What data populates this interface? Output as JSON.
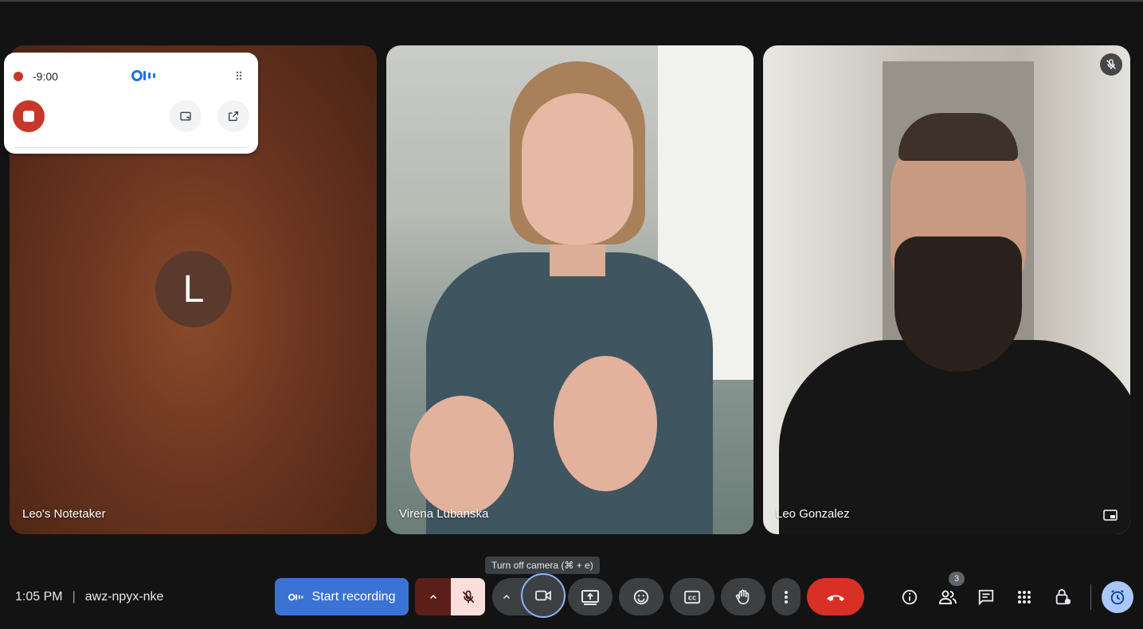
{
  "participants": [
    {
      "name": "Leo's Notetaker",
      "initial": "L"
    },
    {
      "name": "Virena Lubanska"
    },
    {
      "name": "Leo Gonzalez",
      "muted": true
    }
  ],
  "otter_widget": {
    "timer": "-9:00",
    "logo_icon": "otter-logo-icon"
  },
  "meeting": {
    "time": "1:05 PM",
    "separator": "|",
    "code": "awz-npyx-nke"
  },
  "controls": {
    "start_recording_label": "Start recording",
    "camera_tooltip": "Turn off camera (⌘ + e)",
    "people_count": "3"
  },
  "colors": {
    "record_red": "#c5382a",
    "accent_blue": "#3b73d4",
    "hangup_red": "#d93025",
    "mic_muted_bg": "#f9dedc",
    "active_ring": "#8ab4f8"
  }
}
